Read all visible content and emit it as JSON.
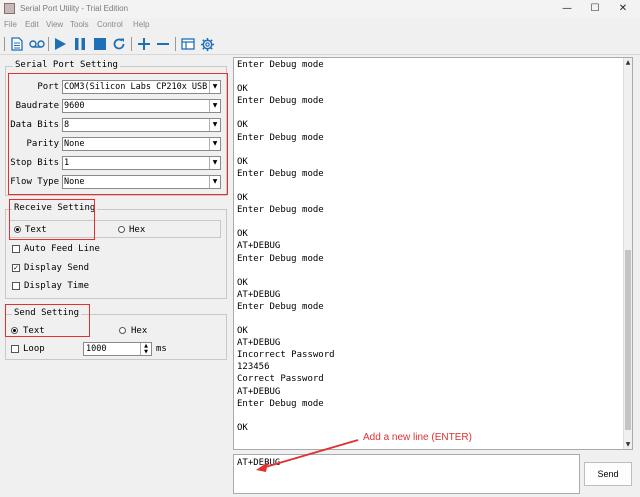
{
  "window": {
    "title": "Serial Port Utility - Trial Edition",
    "min": "—",
    "max": "☐",
    "close": "✕"
  },
  "menu": [
    "File",
    "Edit",
    "View",
    "Tools",
    "Control",
    "Help"
  ],
  "serial_port_setting": {
    "title": "Serial Port Setting",
    "fields": [
      {
        "label": "Port",
        "value": "COM3(Silicon Labs CP210x USB"
      },
      {
        "label": "Baudrate",
        "value": "9600"
      },
      {
        "label": "Data Bits",
        "value": "8"
      },
      {
        "label": "Parity",
        "value": "None"
      },
      {
        "label": "Stop Bits",
        "value": "1"
      },
      {
        "label": "Flow Type",
        "value": "None"
      }
    ]
  },
  "receive_setting": {
    "title": "Receive Setting",
    "text_label": "Text",
    "hex_label": "Hex",
    "auto_feed_label": "Auto Feed Line",
    "display_send_label": "Display Send",
    "display_time_label": "Display Time"
  },
  "send_setting": {
    "title": "Send Setting",
    "text_label": "Text",
    "hex_label": "Hex",
    "loop_label": "Loop",
    "interval": "1000",
    "unit": "ms"
  },
  "receive_log": [
    "Enter Debug mode",
    "",
    "OK",
    "Enter Debug mode",
    "",
    "OK",
    "Enter Debug mode",
    "",
    "OK",
    "Enter Debug mode",
    "",
    "OK",
    "Enter Debug mode",
    "",
    "OK",
    "AT+DEBUG",
    "Enter Debug mode",
    "",
    "OK",
    "AT+DEBUG",
    "Enter Debug mode",
    "",
    "OK",
    "AT+DEBUG",
    "Incorrect Password",
    "123456",
    "Correct Password",
    "AT+DEBUG",
    "Enter Debug mode",
    "",
    "OK"
  ],
  "send_input": "AT+DEBUG",
  "send_button": "Send",
  "annotation": "Add a new line (ENTER)",
  "colors": {
    "highlight": "#e03030",
    "toolbar_icon": "#1f6fb8"
  }
}
